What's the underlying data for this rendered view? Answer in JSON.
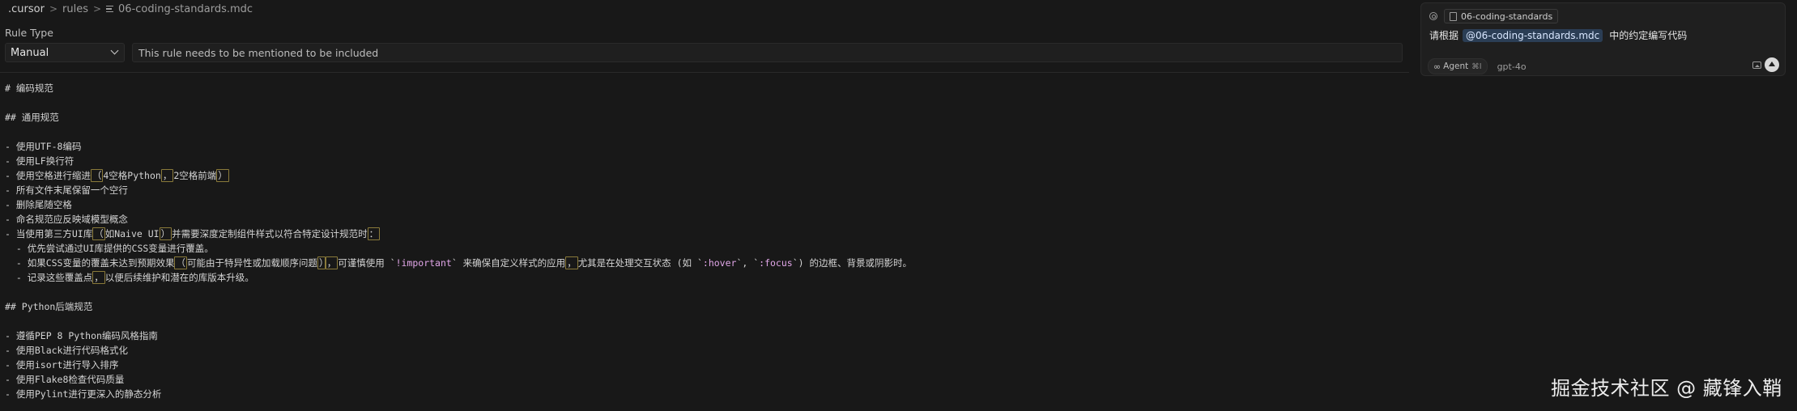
{
  "breadcrumb": {
    "items": [
      ".cursor",
      "rules",
      "06-coding-standards.mdc"
    ],
    "separator": ">"
  },
  "rule": {
    "type_label": "Rule Type",
    "type_value": "Manual",
    "description": "This rule needs to be mentioned to be included"
  },
  "code_lines": [
    {
      "t": "# 编码规范"
    },
    {
      "t": ""
    },
    {
      "t": "## 通用规范"
    },
    {
      "t": ""
    },
    {
      "t": "- 使用UTF-8编码"
    },
    {
      "t": "- 使用LF换行符"
    },
    {
      "t": "- 使用空格进行缩进（4空格Python，2空格前端）"
    },
    {
      "t": "- 所有文件末尾保留一个空行"
    },
    {
      "t": "- 删除尾随空格"
    },
    {
      "t": "- 命名规范应反映域模型概念"
    },
    {
      "t": "- 当使用第三方UI库（如Naive UI）并需要深度定制组件样式以符合特定设计规范时："
    },
    {
      "t": "  - 优先尝试通过UI库提供的CSS变量进行覆盖。"
    },
    {
      "t": "  - 如果CSS变量的覆盖未达到预期效果（可能由于特异性或加载顺序问题），可谨慎使用 `!important` 来确保自定义样式的应用，尤其是在处理交互状态 (如 `:hover`, `:focus`) 的边框、背景或阴影时。"
    },
    {
      "t": "  - 记录这些覆盖点，以便后续维护和潜在的库版本升级。"
    },
    {
      "t": ""
    },
    {
      "t": "## Python后端规范"
    },
    {
      "t": ""
    },
    {
      "t": "- 遵循PEP 8 Python编码风格指南"
    },
    {
      "t": "- 使用Black进行代码格式化"
    },
    {
      "t": "- 使用isort进行导入排序"
    },
    {
      "t": "- 使用Flake8检查代码质量"
    },
    {
      "t": "- 使用Pylint进行更深入的静态分析"
    }
  ],
  "chat": {
    "context_file": "06-coding-standards",
    "prompt_before": "请根据",
    "mention": "@06-coding-standards.mdc",
    "prompt_after": "中的约定编写代码",
    "mode_label": "Agent",
    "mode_shortcut": "⌘I",
    "model": "gpt-4o"
  },
  "watermark": "掘金技术社区 @ 藏锋入鞘",
  "icons": {
    "file": "file-icon",
    "at": "at-icon",
    "doc": "document-icon",
    "agent": "infinity-icon",
    "image": "image-icon",
    "send": "send-arrow-icon"
  },
  "colors": {
    "background": "#181818",
    "mention_bg": "#2b3e55",
    "inline_code": "#e1a6e8",
    "highlight_border": "#8a7a3a"
  }
}
